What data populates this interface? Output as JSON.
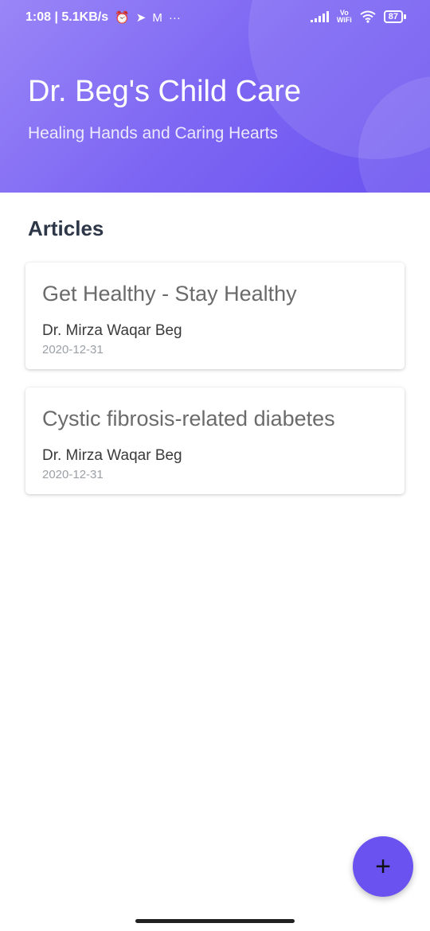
{
  "status_bar": {
    "time": "1:08",
    "network_speed": "5.1KB/s",
    "icons": [
      "alarm-off-icon",
      "telegram-icon",
      "gmail-icon",
      "more-icon"
    ],
    "vo_label": "Vo",
    "wifi_label": "WiFi",
    "battery": "87"
  },
  "header": {
    "title": "Dr. Beg's Child Care",
    "subtitle": "Healing Hands and Caring Hearts",
    "gradient_start": "#9a86f7",
    "gradient_end": "#6a52f0"
  },
  "section": {
    "title": "Articles"
  },
  "articles": [
    {
      "title": "Get Healthy - Stay Healthy",
      "author": "Dr. Mirza Waqar Beg",
      "date": "2020-12-31"
    },
    {
      "title": "Cystic fibrosis-related diabetes",
      "author": "Dr. Mirza Waqar Beg",
      "date": "2020-12-31"
    }
  ],
  "fab": {
    "label": "+",
    "icon": "plus-icon",
    "color": "#6a52f0"
  }
}
